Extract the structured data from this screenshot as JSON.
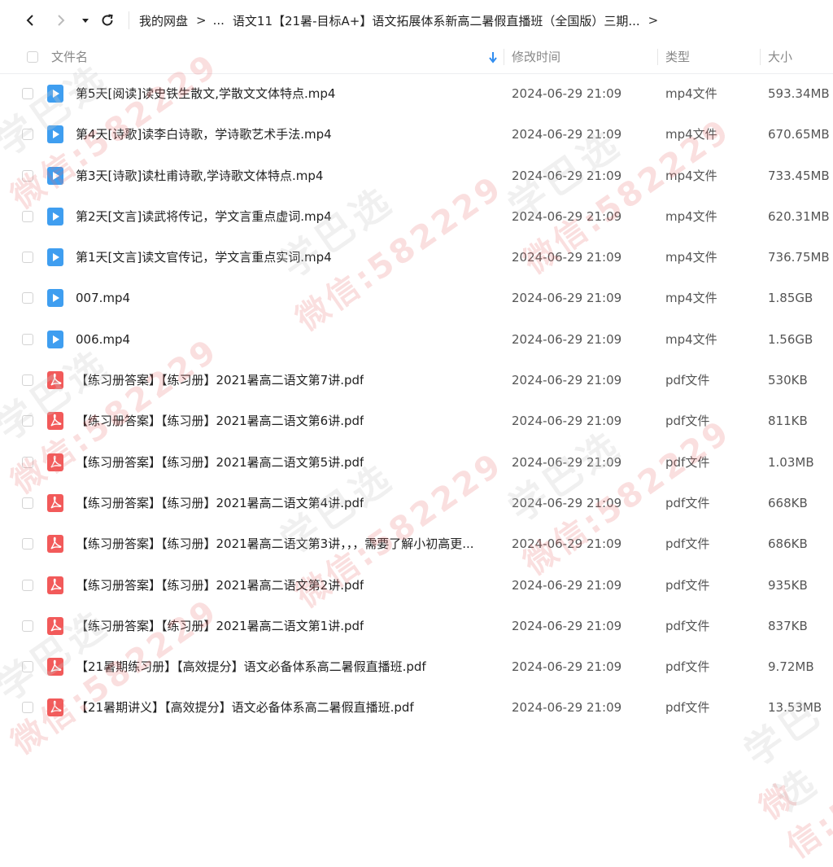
{
  "toolbar": {
    "back_icon": "chevron-left-icon",
    "forward_icon": "chevron-right-icon",
    "dropdown_icon": "caret-down-icon",
    "refresh_icon": "refresh-icon"
  },
  "breadcrumb": {
    "root": "我的网盘",
    "sep1": ">",
    "ellipsis": "...",
    "current": "语文11【21暑-目标A+】语文拓展体系新高二暑假直播班（全国版）三期...",
    "sep2": ">"
  },
  "header": {
    "name": "文件名",
    "modified": "修改时间",
    "type": "类型",
    "size": "大小"
  },
  "files": [
    {
      "name": "第5天[阅读]读史铁生散文,学散文文体特点.mp4",
      "time": "2024-06-29 21:09",
      "type": "mp4文件",
      "size": "593.34MB",
      "kind": "video"
    },
    {
      "name": "第4天[诗歌]读李白诗歌，学诗歌艺术手法.mp4",
      "time": "2024-06-29 21:09",
      "type": "mp4文件",
      "size": "670.65MB",
      "kind": "video"
    },
    {
      "name": "第3天[诗歌]读杜甫诗歌,学诗歌文体特点.mp4",
      "time": "2024-06-29 21:09",
      "type": "mp4文件",
      "size": "733.45MB",
      "kind": "video"
    },
    {
      "name": "第2天[文言]读武将传记，学文言重点虚词.mp4",
      "time": "2024-06-29 21:09",
      "type": "mp4文件",
      "size": "620.31MB",
      "kind": "video"
    },
    {
      "name": "第1天[文言]读文官传记，学文言重点实词.mp4",
      "time": "2024-06-29 21:09",
      "type": "mp4文件",
      "size": "736.75MB",
      "kind": "video"
    },
    {
      "name": "007.mp4",
      "time": "2024-06-29 21:09",
      "type": "mp4文件",
      "size": "1.85GB",
      "kind": "video"
    },
    {
      "name": "006.mp4",
      "time": "2024-06-29 21:09",
      "type": "mp4文件",
      "size": "1.56GB",
      "kind": "video"
    },
    {
      "name": "【练习册答案】【练习册】2021暑高二语文第7讲.pdf",
      "time": "2024-06-29 21:09",
      "type": "pdf文件",
      "size": "530KB",
      "kind": "pdf"
    },
    {
      "name": "【练习册答案】【练习册】2021暑高二语文第6讲.pdf",
      "time": "2024-06-29 21:09",
      "type": "pdf文件",
      "size": "811KB",
      "kind": "pdf"
    },
    {
      "name": "【练习册答案】【练习册】2021暑高二语文第5讲.pdf",
      "time": "2024-06-29 21:09",
      "type": "pdf文件",
      "size": "1.03MB",
      "kind": "pdf"
    },
    {
      "name": "【练习册答案】【练习册】2021暑高二语文第4讲.pdf",
      "time": "2024-06-29 21:09",
      "type": "pdf文件",
      "size": "668KB",
      "kind": "pdf"
    },
    {
      "name": "【练习册答案】【练习册】2021暑高二语文第3讲，，，需要了解小初高更...",
      "time": "2024-06-29 21:09",
      "type": "pdf文件",
      "size": "686KB",
      "kind": "pdf"
    },
    {
      "name": "【练习册答案】【练习册】2021暑高二语文第2讲.pdf",
      "time": "2024-06-29 21:09",
      "type": "pdf文件",
      "size": "935KB",
      "kind": "pdf"
    },
    {
      "name": "【练习册答案】【练习册】2021暑高二语文第1讲.pdf",
      "time": "2024-06-29 21:09",
      "type": "pdf文件",
      "size": "837KB",
      "kind": "pdf"
    },
    {
      "name": "【21暑期练习册】【高效提分】语文必备体系高二暑假直播班.pdf",
      "time": "2024-06-29 21:09",
      "type": "pdf文件",
      "size": "9.72MB",
      "kind": "pdf"
    },
    {
      "name": "【21暑期讲义】【高效提分】语文必备体系高二暑假直播班.pdf",
      "time": "2024-06-29 21:09",
      "type": "pdf文件",
      "size": "13.53MB",
      "kind": "pdf"
    }
  ],
  "watermark": {
    "brand": "学巴选",
    "contact": "微信:582229"
  },
  "colors": {
    "video_icon": "#3f9ef0",
    "pdf_icon": "#f25a5a",
    "sort_arrow": "#2f8cf0"
  }
}
